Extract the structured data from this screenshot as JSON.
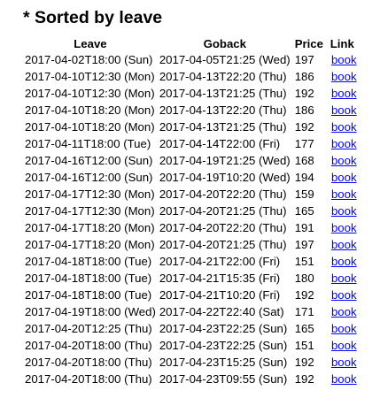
{
  "title": "* Sorted by leave",
  "table": {
    "headers": [
      "Leave",
      "Goback",
      "Price",
      "Link"
    ],
    "rows": [
      {
        "leave": "2017-04-02T18:00 (Sun)",
        "goback": "2017-04-05T21:25 (Wed)",
        "price": "197",
        "link": "book"
      },
      {
        "leave": "2017-04-10T12:30 (Mon)",
        "goback": "2017-04-13T22:20 (Thu)",
        "price": "186",
        "link": "book"
      },
      {
        "leave": "2017-04-10T12:30 (Mon)",
        "goback": "2017-04-13T21:25 (Thu)",
        "price": "192",
        "link": "book"
      },
      {
        "leave": "2017-04-10T18:20 (Mon)",
        "goback": "2017-04-13T22:20 (Thu)",
        "price": "186",
        "link": "book"
      },
      {
        "leave": "2017-04-10T18:20 (Mon)",
        "goback": "2017-04-13T21:25 (Thu)",
        "price": "192",
        "link": "book"
      },
      {
        "leave": "2017-04-11T18:00 (Tue)",
        "goback": "2017-04-14T22:00 (Fri)",
        "price": "177",
        "link": "book"
      },
      {
        "leave": "2017-04-16T12:00 (Sun)",
        "goback": "2017-04-19T21:25 (Wed)",
        "price": "168",
        "link": "book"
      },
      {
        "leave": "2017-04-16T12:00 (Sun)",
        "goback": "2017-04-19T10:20 (Wed)",
        "price": "194",
        "link": "book"
      },
      {
        "leave": "2017-04-17T12:30 (Mon)",
        "goback": "2017-04-20T22:20 (Thu)",
        "price": "159",
        "link": "book"
      },
      {
        "leave": "2017-04-17T12:30 (Mon)",
        "goback": "2017-04-20T21:25 (Thu)",
        "price": "165",
        "link": "book"
      },
      {
        "leave": "2017-04-17T18:20 (Mon)",
        "goback": "2017-04-20T22:20 (Thu)",
        "price": "191",
        "link": "book"
      },
      {
        "leave": "2017-04-17T18:20 (Mon)",
        "goback": "2017-04-20T21:25 (Thu)",
        "price": "197",
        "link": "book"
      },
      {
        "leave": "2017-04-18T18:00 (Tue)",
        "goback": "2017-04-21T22:00 (Fri)",
        "price": "151",
        "link": "book"
      },
      {
        "leave": "2017-04-18T18:00 (Tue)",
        "goback": "2017-04-21T15:35 (Fri)",
        "price": "180",
        "link": "book"
      },
      {
        "leave": "2017-04-18T18:00 (Tue)",
        "goback": "2017-04-21T10:20 (Fri)",
        "price": "192",
        "link": "book"
      },
      {
        "leave": "2017-04-19T18:00 (Wed)",
        "goback": "2017-04-22T22:40 (Sat)",
        "price": "171",
        "link": "book"
      },
      {
        "leave": "2017-04-20T12:25 (Thu)",
        "goback": "2017-04-23T22:25 (Sun)",
        "price": "165",
        "link": "book"
      },
      {
        "leave": "2017-04-20T18:00 (Thu)",
        "goback": "2017-04-23T22:25 (Sun)",
        "price": "151",
        "link": "book"
      },
      {
        "leave": "2017-04-20T18:00 (Thu)",
        "goback": "2017-04-23T15:25 (Sun)",
        "price": "192",
        "link": "book"
      },
      {
        "leave": "2017-04-20T18:00 (Thu)",
        "goback": "2017-04-23T09:55 (Sun)",
        "price": "192",
        "link": "book"
      }
    ]
  },
  "colors": {
    "link": "#0000ee",
    "text": "#000000",
    "background": "#ffffff"
  }
}
